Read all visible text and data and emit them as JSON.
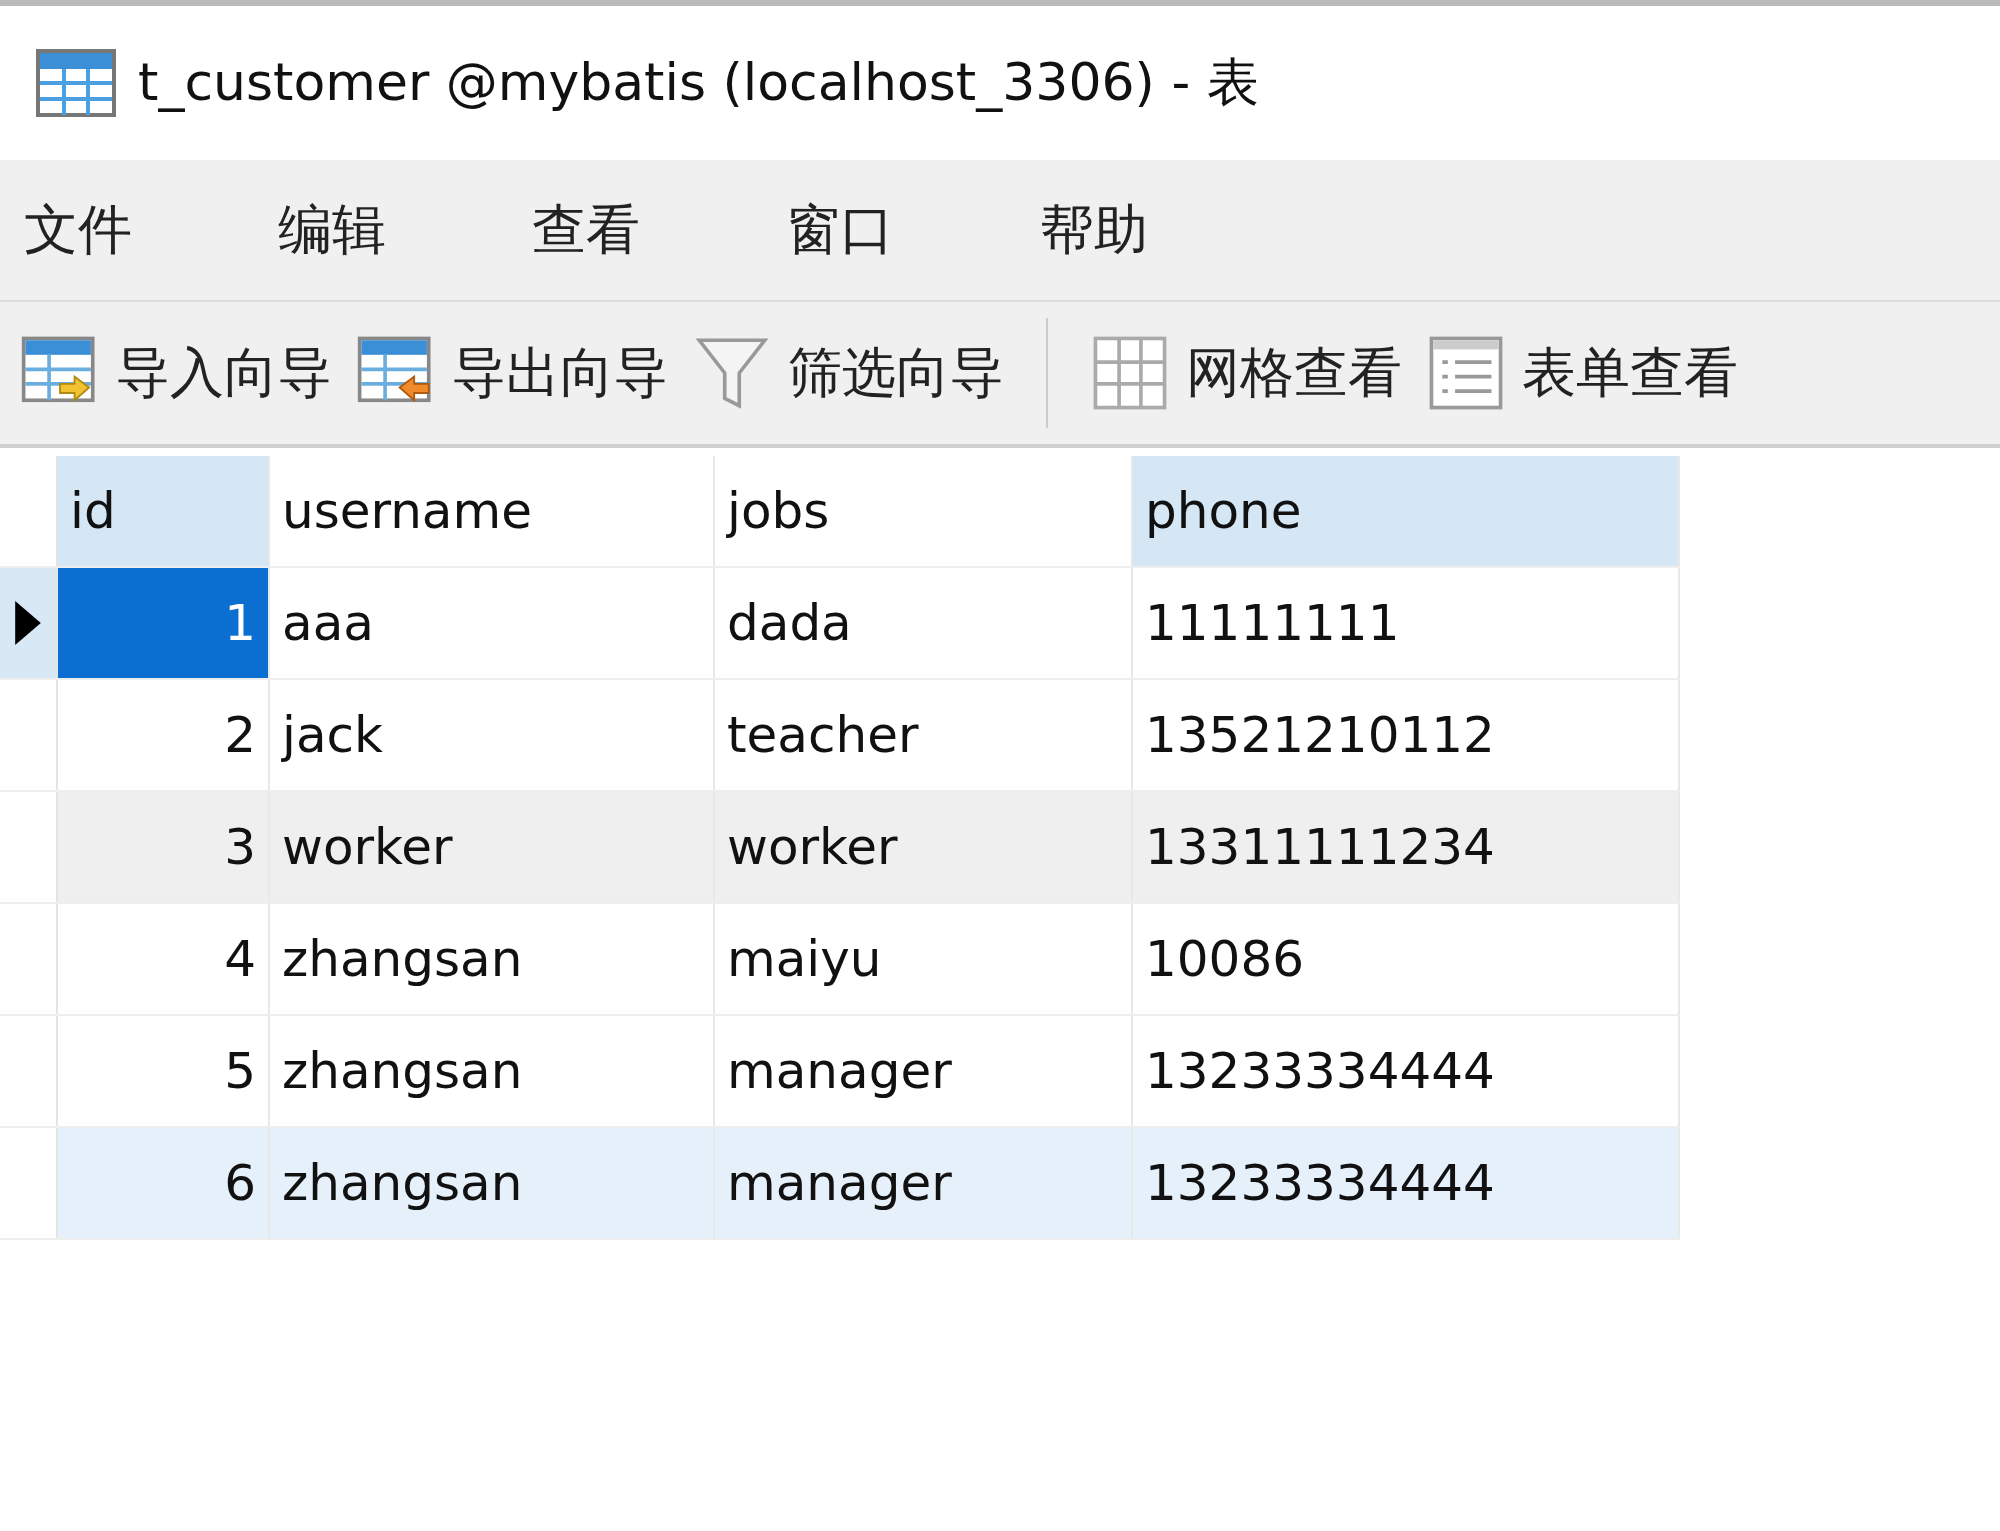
{
  "window": {
    "title": "t_customer @mybatis (localhost_3306) - 表"
  },
  "menu": [
    "文件",
    "编辑",
    "查看",
    "窗口",
    "帮助"
  ],
  "toolbar": [
    {
      "kind": "import",
      "label": "导入向导"
    },
    {
      "kind": "export",
      "label": "导出向导"
    },
    {
      "kind": "filter",
      "label": "筛选向导"
    },
    {
      "kind": "separator"
    },
    {
      "kind": "grid",
      "label": "网格查看"
    },
    {
      "kind": "form",
      "label": "表单查看"
    }
  ],
  "table": {
    "columns": [
      {
        "label": "id",
        "highlighted": true
      },
      {
        "label": "username",
        "highlighted": false
      },
      {
        "label": "jobs",
        "highlighted": false
      },
      {
        "label": "phone",
        "highlighted": true
      }
    ],
    "rows": [
      {
        "cells": [
          "1",
          "aaa",
          "dada",
          "11111111"
        ],
        "current": true,
        "hovered": false,
        "highlighted": false
      },
      {
        "cells": [
          "2",
          "jack",
          "teacher",
          "13521210112"
        ],
        "current": false,
        "hovered": false,
        "highlighted": false
      },
      {
        "cells": [
          "3",
          "worker",
          "worker",
          "13311111234"
        ],
        "current": false,
        "hovered": true,
        "highlighted": false
      },
      {
        "cells": [
          "4",
          "zhangsan",
          "maiyu",
          "10086"
        ],
        "current": false,
        "hovered": false,
        "highlighted": false
      },
      {
        "cells": [
          "5",
          "zhangsan",
          "manager",
          "13233334444"
        ],
        "current": false,
        "hovered": false,
        "highlighted": false
      },
      {
        "cells": [
          "6",
          "zhangsan",
          "manager",
          "13233334444"
        ],
        "current": false,
        "hovered": false,
        "highlighted": true
      }
    ]
  }
}
